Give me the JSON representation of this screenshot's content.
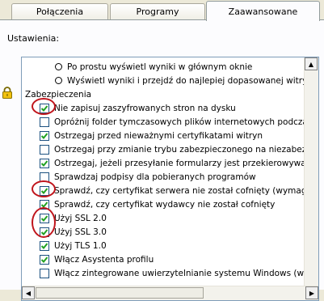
{
  "tabs": [
    {
      "label": "Połączenia",
      "active": false
    },
    {
      "label": "Programy",
      "active": false
    },
    {
      "label": "Zaawansowane",
      "active": true
    }
  ],
  "settings_label": "Ustawienia:",
  "radios": [
    {
      "label": "Po prostu wyświetl wyniki w głównym oknie"
    },
    {
      "label": "Wyświetl wyniki i przejdź do najlepiej dopasowanej witryny"
    }
  ],
  "section": {
    "label": "Zabezpieczenia",
    "icon": "lock-icon"
  },
  "options": [
    {
      "label": "Nie zapisuj zaszyfrowanych stron na dysku",
      "checked": true
    },
    {
      "label": "Opróżnij folder tymczasowych plików internetowych podczas za",
      "checked": false
    },
    {
      "label": "Ostrzegaj przed nieważnymi certyfikatami witryn",
      "checked": true
    },
    {
      "label": "Ostrzegaj przy zmianie trybu zabezpieczonego na niezabezpiec",
      "checked": false
    },
    {
      "label": "Ostrzegaj, jeżeli przesyłanie formularzy jest przekierowywane",
      "checked": true
    },
    {
      "label": "Sprawdzaj podpisy dla pobieranych programów",
      "checked": false
    },
    {
      "label": "Sprawdź, czy certyfikat serwera nie został cofnięty (wymaga pc",
      "checked": true
    },
    {
      "label": "Sprawdź, czy certyfikat wydawcy nie został cofnięty",
      "checked": true
    },
    {
      "label": "Użyj SSL 2.0",
      "checked": true
    },
    {
      "label": "Użyj SSL 3.0",
      "checked": true
    },
    {
      "label": "Użyj TLS 1.0",
      "checked": true
    },
    {
      "label": "Włącz Asystenta profilu",
      "checked": true
    },
    {
      "label": "Włącz zintegrowane uwierzytelnianie systemu Windows (wyma",
      "checked": false
    }
  ],
  "highlight_color": "#C0151C"
}
